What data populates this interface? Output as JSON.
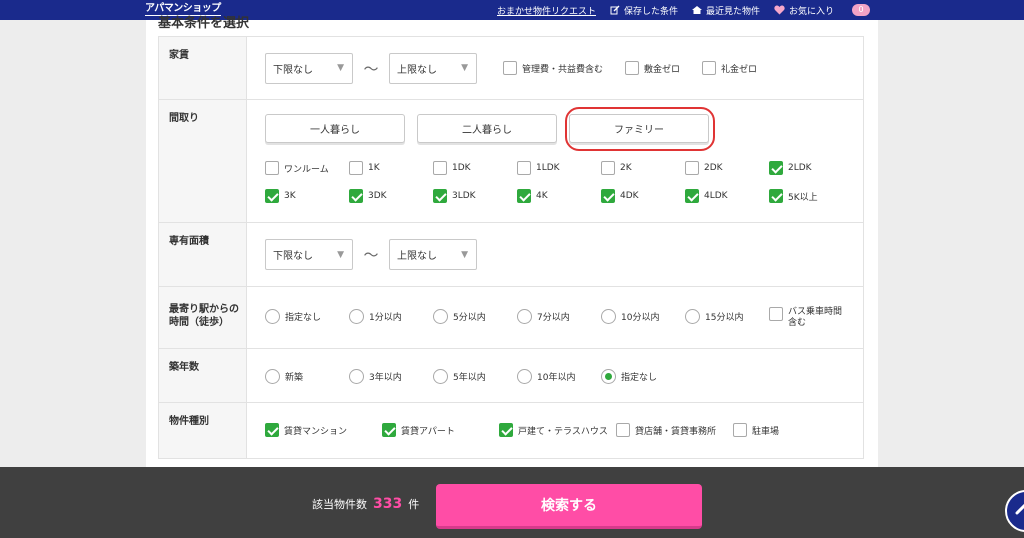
{
  "header": {
    "logo": "アパマンショップ",
    "nav": {
      "request": "おまかせ物件リクエスト",
      "saved": "保存した条件",
      "recent": "最近見た物件",
      "favorites": "お気に入り",
      "favorites_count": "0"
    }
  },
  "section_heading": "基本条件を選択",
  "rent": {
    "label": "家賃",
    "min": "下限なし",
    "tilde": "〜",
    "max": "上限なし",
    "options": [
      {
        "label": "管理費・共益費含む",
        "checked": false
      },
      {
        "label": "敷金ゼロ",
        "checked": false
      },
      {
        "label": "礼金ゼロ",
        "checked": false
      }
    ]
  },
  "layout": {
    "label": "間取り",
    "buttons": [
      "一人暮らし",
      "二人暮らし",
      "ファミリー"
    ],
    "options": [
      {
        "label": "ワンルーム",
        "checked": false
      },
      {
        "label": "1K",
        "checked": false
      },
      {
        "label": "1DK",
        "checked": false
      },
      {
        "label": "1LDK",
        "checked": false
      },
      {
        "label": "2K",
        "checked": false
      },
      {
        "label": "2DK",
        "checked": false
      },
      {
        "label": "2LDK",
        "checked": true
      },
      {
        "label": "3K",
        "checked": true
      },
      {
        "label": "3DK",
        "checked": true
      },
      {
        "label": "3LDK",
        "checked": true
      },
      {
        "label": "4K",
        "checked": true
      },
      {
        "label": "4DK",
        "checked": true
      },
      {
        "label": "4LDK",
        "checked": true
      },
      {
        "label": "5K以上",
        "checked": true
      }
    ]
  },
  "area": {
    "label": "専有面積",
    "min": "下限なし",
    "tilde": "〜",
    "max": "上限なし"
  },
  "station": {
    "label_line1": "最寄り駅からの",
    "label_line2": "時間（徒歩）",
    "options": [
      {
        "label": "指定なし",
        "checked": false
      },
      {
        "label": "1分以内",
        "checked": false
      },
      {
        "label": "5分以内",
        "checked": false
      },
      {
        "label": "7分以内",
        "checked": false
      },
      {
        "label": "10分以内",
        "checked": false
      },
      {
        "label": "15分以内",
        "checked": false
      }
    ],
    "bus_line1": "バス乗車時間",
    "bus_line2": "含む"
  },
  "age": {
    "label": "築年数",
    "options": [
      {
        "label": "新築",
        "checked": false
      },
      {
        "label": "3年以内",
        "checked": false
      },
      {
        "label": "5年以内",
        "checked": false
      },
      {
        "label": "10年以内",
        "checked": false
      },
      {
        "label": "指定なし",
        "checked": true
      }
    ]
  },
  "property_type": {
    "label": "物件種別",
    "options": [
      {
        "label": "賃貸マンション",
        "checked": true
      },
      {
        "label": "賃貸アパート",
        "checked": true
      },
      {
        "label": "戸建て・テラスハウス",
        "checked": true
      },
      {
        "label": "貸店舗・賃貸事務所",
        "checked": false
      },
      {
        "label": "駐車場",
        "checked": false
      }
    ]
  },
  "footer": {
    "count_label": "該当物件数",
    "count": "333",
    "count_unit": "件",
    "search_label": "検索する"
  },
  "colors": {
    "header": "#1a2a8c",
    "check_green": "#2fa93d",
    "accent_pink": "#ff4da6",
    "highlight_red": "#e03434"
  }
}
